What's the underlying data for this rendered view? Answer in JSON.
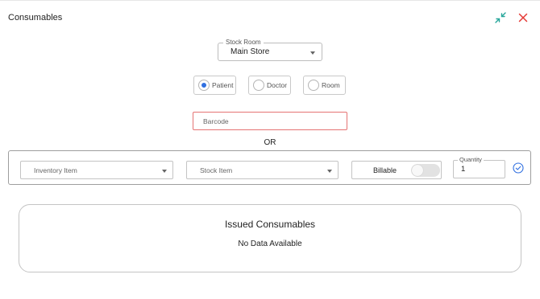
{
  "dialog": {
    "title": "Consumables",
    "collapse_icon": "collapse-arrows-icon",
    "close_icon": "close-icon"
  },
  "stock_room": {
    "label": "Stock Room",
    "value": "Main Store"
  },
  "target": {
    "options": [
      {
        "label": "Patient",
        "checked": true
      },
      {
        "label": "Doctor",
        "checked": false
      },
      {
        "label": "Room",
        "checked": false
      }
    ]
  },
  "barcode": {
    "placeholder": "Barcode",
    "value": ""
  },
  "separator": "OR",
  "item_row": {
    "inventory_placeholder": "Inventory Item",
    "stock_placeholder": "Stock Item",
    "billable_label": "Billable",
    "billable_on": false,
    "quantity_label": "Quantity",
    "quantity_value": "1",
    "confirm_icon": "check-circle-icon"
  },
  "issued": {
    "title": "Issued Consumables",
    "empty_text": "No Data Available"
  },
  "colors": {
    "accent": "#2f6fe0",
    "error_border": "#e57373",
    "close": "#e53935",
    "collapse": "#26a69a"
  }
}
